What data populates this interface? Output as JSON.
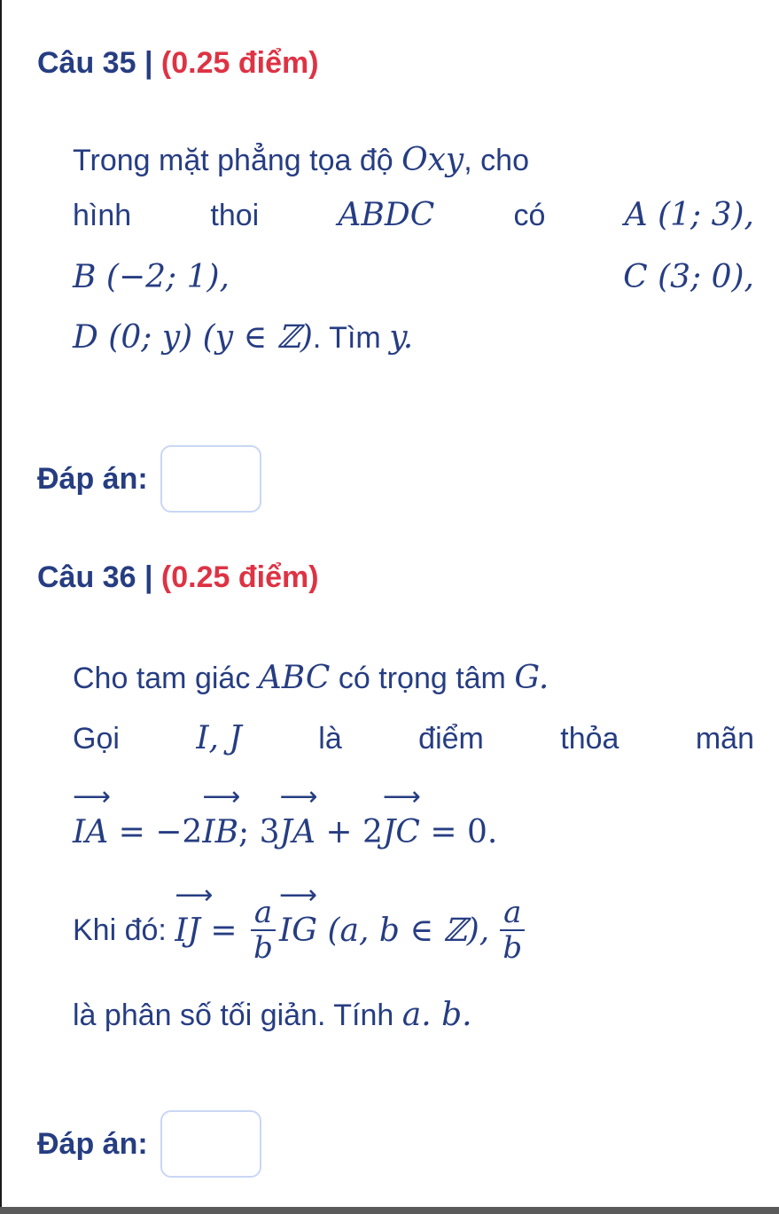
{
  "questions": [
    {
      "title_number": "Câu 35 |",
      "title_points": "(0.25 điểm)",
      "lines": {
        "l1_text": "Trong mặt phẳng tọa độ",
        "l1_math": "Oxy",
        "l1_tail": ", cho",
        "l2_w1": "hình",
        "l2_w2": "thoi",
        "l2_math": "ABDC",
        "l2_w3": "có",
        "l2_point": "A (1; 3),",
        "l3_point_b": "B (−2; 1),",
        "l3_point_c": "C (3; 0),",
        "l4_math": "D (0; y) (y ∈ ℤ)",
        "l4_text": ". Tìm",
        "l4_var": "y."
      },
      "answer_label": "Đáp án:",
      "answer_value": ""
    },
    {
      "title_number": "Câu 36 |",
      "title_points": "(0.25 điểm)",
      "lines": {
        "l1_text": "Cho tam giác",
        "l1_math": "ABC",
        "l1_text2": "có trọng tâm",
        "l1_math2": "G.",
        "l2_w1": "Gọi",
        "l2_math": "I, J",
        "l2_w2": "là",
        "l2_w3": "điểm",
        "l2_w4": "thỏa",
        "l2_w5": "mãn",
        "eq_ia": "IA",
        "eq_part1": " = −2",
        "eq_ib": "IB",
        "eq_part2": "; 3",
        "eq_ja": "JA",
        "eq_part3": " + 2",
        "eq_jc": "JC",
        "eq_part4": " = 0.",
        "arrow": "⟶",
        "l4_text": "Khi đó:",
        "l4_ij": "IJ",
        "l4_eq": " = ",
        "frac_num": "a",
        "frac_den": "b",
        "l4_ig": "IG",
        "l4_cond": " (a, b ∈ ℤ),",
        "l5_text": "là phân số tối giản. Tính",
        "l5_math": "a. b."
      },
      "answer_label": "Đáp án:",
      "answer_value": ""
    }
  ],
  "colors": {
    "title_blue": "#263d82",
    "points_red": "#dd3344",
    "text_blue": "#263d82",
    "box_border": "#c9d7f5"
  }
}
